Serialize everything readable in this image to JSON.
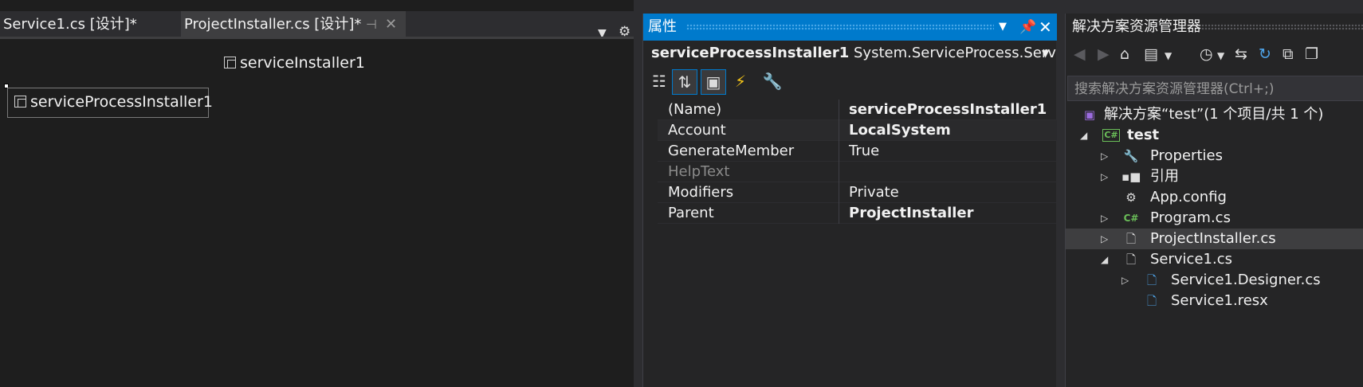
{
  "designer": {
    "tabs": [
      {
        "label": "Service1.cs [设计]*"
      },
      {
        "label": "ProjectInstaller.cs [设计]*"
      }
    ],
    "components": {
      "service_installer": "serviceInstaller1",
      "process_installer": "serviceProcessInstaller1"
    }
  },
  "properties": {
    "title": "属性",
    "selected_object_name": "serviceProcessInstaller1",
    "selected_object_type": "System.ServiceProcess.ServiceI",
    "rows": [
      {
        "name": "(Name)",
        "value": "serviceProcessInstaller1"
      },
      {
        "name": "Account",
        "value": "LocalSystem"
      },
      {
        "name": "GenerateMember",
        "value": "True"
      },
      {
        "name": "HelpText",
        "value": ""
      },
      {
        "name": "Modifiers",
        "value": "Private"
      },
      {
        "name": "Parent",
        "value": "ProjectInstaller"
      }
    ]
  },
  "solution_explorer": {
    "title": "解决方案资源管理器",
    "search_placeholder": "搜索解决方案资源管理器(Ctrl+;)",
    "tree": [
      {
        "label": "解决方案“test”(1 个项目/共 1 个)"
      },
      {
        "label": "test"
      },
      {
        "label": "Properties"
      },
      {
        "label": "引用"
      },
      {
        "label": "App.config"
      },
      {
        "label": "Program.cs"
      },
      {
        "label": "ProjectInstaller.cs"
      },
      {
        "label": "Service1.cs"
      },
      {
        "label": "Service1.Designer.cs"
      },
      {
        "label": "Service1.resx"
      }
    ]
  },
  "colors": {
    "accent": "#007acc",
    "background": "#1e1e1e",
    "panel": "#252526"
  }
}
